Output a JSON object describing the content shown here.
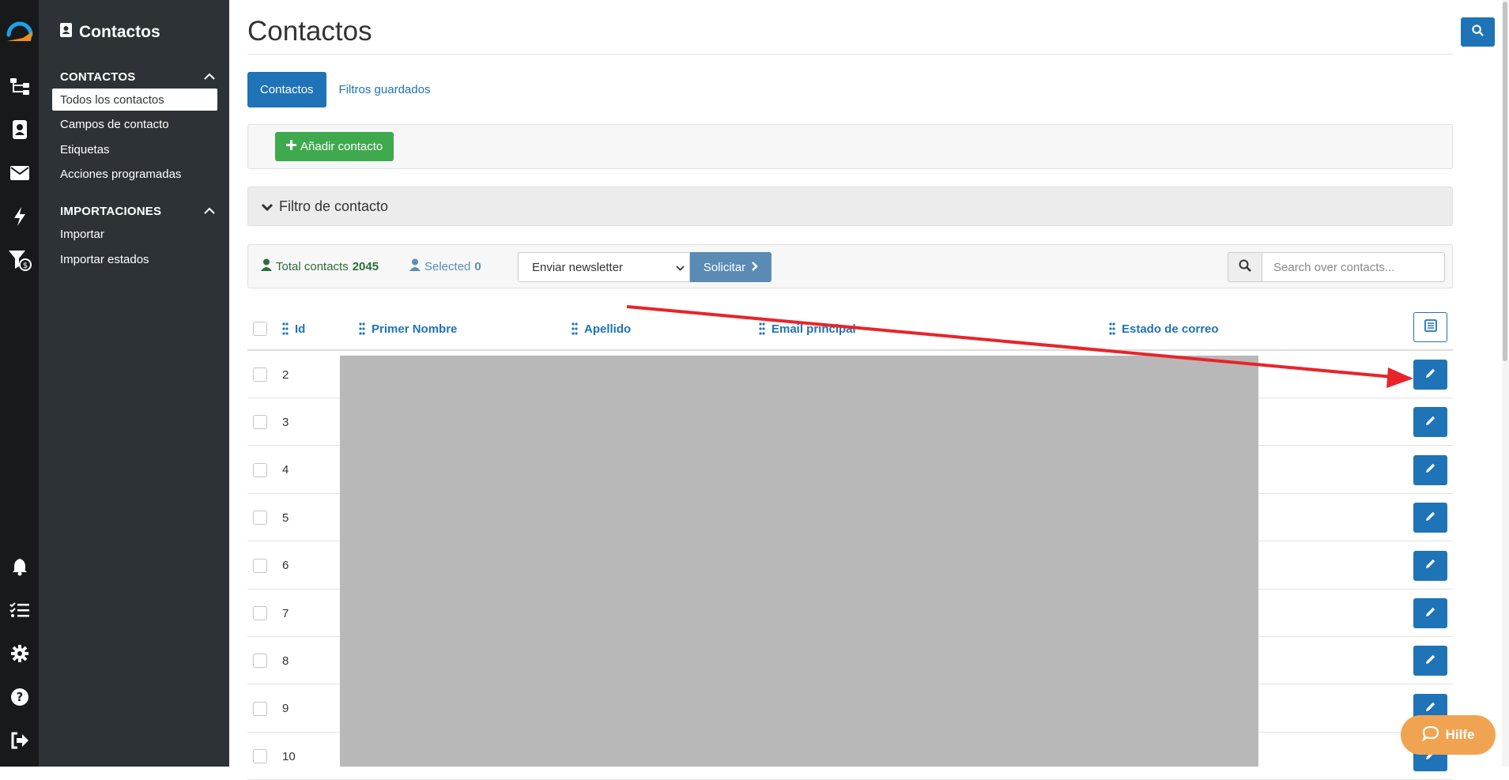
{
  "rail": {
    "icons": [
      "brand-logo-icon",
      "workflow-icon",
      "contacts-book-icon",
      "envelope-icon",
      "bolt-icon",
      "filter-dollar-icon",
      "bell-icon",
      "task-list-icon",
      "gear-icon",
      "help-icon",
      "logout-icon"
    ]
  },
  "sidebar": {
    "title": "Contactos",
    "sections": [
      {
        "label": "CONTACTOS",
        "items": [
          "Todos los contactos",
          "Campos de contacto",
          "Etiquetas",
          "Acciones programadas"
        ]
      },
      {
        "label": "IMPORTACIONES",
        "items": [
          "Importar",
          "Importar estados"
        ]
      }
    ],
    "active_item": "Todos los contactos"
  },
  "page": {
    "title": "Contactos"
  },
  "tabs": [
    {
      "label": "Contactos",
      "active": true
    },
    {
      "label": "Filtros guardados",
      "active": false
    }
  ],
  "toolbar": {
    "add_label": "Añadir contacto"
  },
  "filter": {
    "label": "Filtro de contacto"
  },
  "stats": {
    "total_label": "Total contacts",
    "total_value": "2045",
    "selected_label": "Selected",
    "selected_value": "0"
  },
  "bulk_action": {
    "selected_option": "Enviar newsletter",
    "apply_label": "Solicitar"
  },
  "search": {
    "placeholder": "Search over contacts..."
  },
  "table": {
    "headers": [
      "Id",
      "Primer Nombre",
      "Apellido",
      "Email principal",
      "Estado de correo"
    ],
    "rows": [
      {
        "id": "2"
      },
      {
        "id": "3"
      },
      {
        "id": "4"
      },
      {
        "id": "5"
      },
      {
        "id": "6"
      },
      {
        "id": "7"
      },
      {
        "id": "8"
      },
      {
        "id": "9"
      },
      {
        "id": "10"
      }
    ]
  },
  "help_widget": {
    "label": "Hilfe"
  },
  "colors": {
    "primary": "#1f73b7",
    "success": "#3fa94e",
    "sidebar_bg": "#2c3235",
    "rail_bg": "#17191b",
    "annotation_arrow": "#e8242a",
    "help_bg": "#f0a451"
  }
}
